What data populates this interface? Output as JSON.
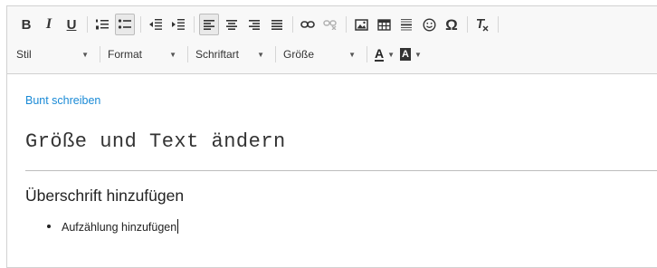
{
  "toolbar": {
    "row1": {
      "bold": "B",
      "italic": "I",
      "underline": "U",
      "special_char": "Ω"
    },
    "combos": {
      "style": "Stil",
      "format": "Format",
      "font": "Schriftart",
      "size": "Größe"
    },
    "text_color_letter": "A",
    "bg_color_letter": "A"
  },
  "content": {
    "link_text": "Bunt schreiben",
    "monospace_line": "Größe und Text ändern",
    "heading": "Überschrift hinzufügen",
    "bullet_items": [
      "Aufzählung hinzufügen"
    ]
  }
}
